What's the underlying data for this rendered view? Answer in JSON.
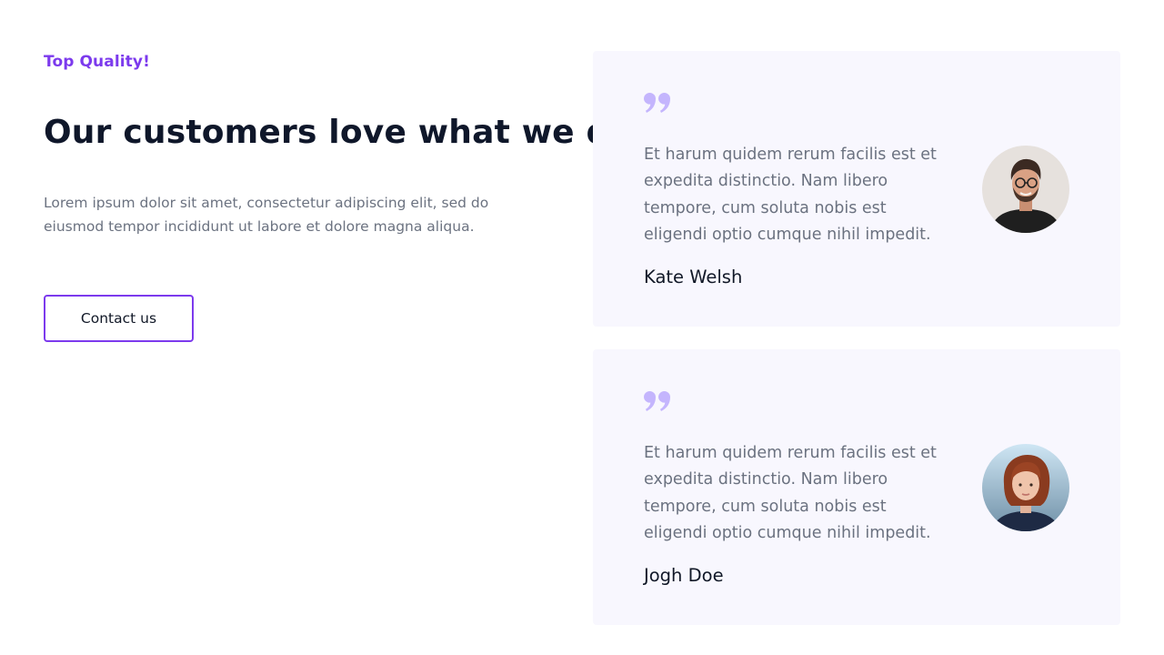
{
  "hero": {
    "eyebrow": "Top Quality!",
    "headline": "Our customers love what we do",
    "lead": "Lorem ipsum dolor sit amet, consectetur adipiscing elit, sed do eiusmod tempor incididunt ut labore et dolore magna aliqua.",
    "button_label": "Contact us"
  },
  "testimonials": [
    {
      "text": "Et harum quidem rerum facilis est et expedita distinctio. Nam libero tempore, cum soluta nobis est eligendi optio cumque nihil impedit.",
      "name": "Kate Welsh",
      "icon": "quote-icon"
    },
    {
      "text": "Et harum quidem rerum facilis est et expedita distinctio. Nam libero tempore, cum soluta nobis est eligendi optio cumque nihil impedit.",
      "name": "Jogh Doe",
      "icon": "quote-icon"
    }
  ],
  "colors": {
    "accent": "#7c3aed",
    "quote": "#c4b5fd",
    "card_bg": "#f8f7fe",
    "heading": "#0f172a",
    "body_text": "#6b7280"
  }
}
